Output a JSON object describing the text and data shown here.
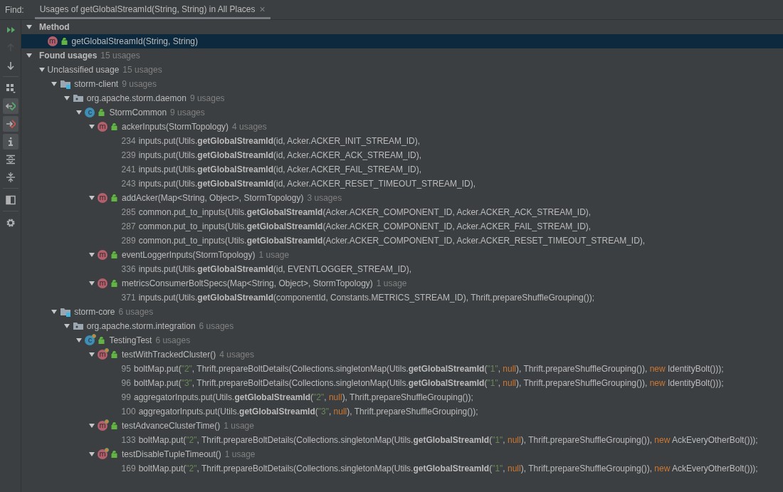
{
  "find_label": "Find:",
  "tab": {
    "title": "Usages of getGlobalStreamId(String, String) in All Places",
    "close": "×",
    "selected": true
  },
  "toolbar": [
    [
      {
        "kind": "rerun",
        "on": false,
        "disabled": false
      },
      {
        "kind": "previous",
        "on": false,
        "disabled": true
      },
      {
        "kind": "next",
        "on": false,
        "disabled": false
      }
    ],
    [
      {
        "kind": "group",
        "on": false,
        "disabled": false
      },
      {
        "kind": "export",
        "on": true,
        "disabled": false
      },
      {
        "kind": "import",
        "on": true,
        "disabled": false
      },
      {
        "kind": "info",
        "on": true,
        "disabled": false
      },
      {
        "kind": "expand-all",
        "on": false,
        "disabled": false
      },
      {
        "kind": "collapse-all",
        "on": false,
        "disabled": false
      }
    ],
    [
      {
        "kind": "preview",
        "on": false,
        "disabled": false
      }
    ],
    [
      {
        "kind": "settings",
        "on": false,
        "disabled": false
      }
    ]
  ],
  "tree": [
    {
      "kind": "group",
      "label": "Method",
      "expanded": true,
      "selected": false,
      "children": [
        {
          "kind": "method",
          "badge": "m",
          "test": false,
          "label": "getGlobalStreamId(String, String)",
          "selected": true
        }
      ]
    },
    {
      "kind": "group",
      "label": "Found usages",
      "count": "15 usages",
      "expanded": true,
      "selected": false,
      "children": [
        {
          "kind": "category",
          "label": "Unclassified usage",
          "count": "15 usages",
          "expanded": true,
          "selected": false,
          "children": [
            {
              "kind": "module",
              "label": "storm-client",
              "count": "9 usages",
              "expanded": true,
              "selected": false,
              "children": [
                {
                  "kind": "package",
                  "label": "org.apache.storm.daemon",
                  "count": "9 usages",
                  "expanded": true,
                  "selected": false,
                  "children": [
                    {
                      "kind": "class",
                      "badge": "c",
                      "test": false,
                      "label": "StormCommon",
                      "count": "9 usages",
                      "expanded": true,
                      "selected": false,
                      "children": [
                        {
                          "kind": "method",
                          "badge": "m",
                          "test": false,
                          "label": "ackerInputs(StormTopology)",
                          "count": "4 usages",
                          "expanded": true,
                          "selected": false,
                          "children": [
                            {
                              "kind": "usage",
                              "line": "234",
                              "selected": false,
                              "segments": [
                                {
                                  "kind": "plain",
                                  "text": "inputs.put(Utils."
                                },
                                {
                                  "kind": "match",
                                  "text": "getGlobalStreamId"
                                },
                                {
                                  "kind": "plain",
                                  "text": "(id, Acker.ACKER_INIT_STREAM_ID),"
                                }
                              ]
                            },
                            {
                              "kind": "usage",
                              "line": "239",
                              "selected": false,
                              "segments": [
                                {
                                  "kind": "plain",
                                  "text": "inputs.put(Utils."
                                },
                                {
                                  "kind": "match",
                                  "text": "getGlobalStreamId"
                                },
                                {
                                  "kind": "plain",
                                  "text": "(id, Acker.ACKER_ACK_STREAM_ID),"
                                }
                              ]
                            },
                            {
                              "kind": "usage",
                              "line": "241",
                              "selected": false,
                              "segments": [
                                {
                                  "kind": "plain",
                                  "text": "inputs.put(Utils."
                                },
                                {
                                  "kind": "match",
                                  "text": "getGlobalStreamId"
                                },
                                {
                                  "kind": "plain",
                                  "text": "(id, Acker.ACKER_FAIL_STREAM_ID),"
                                }
                              ]
                            },
                            {
                              "kind": "usage",
                              "line": "243",
                              "selected": false,
                              "segments": [
                                {
                                  "kind": "plain",
                                  "text": "inputs.put(Utils."
                                },
                                {
                                  "kind": "match",
                                  "text": "getGlobalStreamId"
                                },
                                {
                                  "kind": "plain",
                                  "text": "(id, Acker.ACKER_RESET_TIMEOUT_STREAM_ID),"
                                }
                              ]
                            }
                          ]
                        },
                        {
                          "kind": "method",
                          "badge": "m",
                          "test": false,
                          "label": "addAcker(Map<String, Object>, StormTopology)",
                          "count": "3 usages",
                          "expanded": true,
                          "selected": false,
                          "children": [
                            {
                              "kind": "usage",
                              "line": "285",
                              "selected": false,
                              "segments": [
                                {
                                  "kind": "plain",
                                  "text": "common.put_to_inputs(Utils."
                                },
                                {
                                  "kind": "match",
                                  "text": "getGlobalStreamId"
                                },
                                {
                                  "kind": "plain",
                                  "text": "(Acker.ACKER_COMPONENT_ID, Acker.ACKER_ACK_STREAM_ID),"
                                }
                              ]
                            },
                            {
                              "kind": "usage",
                              "line": "287",
                              "selected": false,
                              "segments": [
                                {
                                  "kind": "plain",
                                  "text": "common.put_to_inputs(Utils."
                                },
                                {
                                  "kind": "match",
                                  "text": "getGlobalStreamId"
                                },
                                {
                                  "kind": "plain",
                                  "text": "(Acker.ACKER_COMPONENT_ID, Acker.ACKER_FAIL_STREAM_ID),"
                                }
                              ]
                            },
                            {
                              "kind": "usage",
                              "line": "289",
                              "selected": false,
                              "segments": [
                                {
                                  "kind": "plain",
                                  "text": "common.put_to_inputs(Utils."
                                },
                                {
                                  "kind": "match",
                                  "text": "getGlobalStreamId"
                                },
                                {
                                  "kind": "plain",
                                  "text": "(Acker.ACKER_COMPONENT_ID, Acker.ACKER_RESET_TIMEOUT_STREAM_ID),"
                                }
                              ]
                            }
                          ]
                        },
                        {
                          "kind": "method",
                          "badge": "m",
                          "test": false,
                          "label": "eventLoggerInputs(StormTopology)",
                          "count": "1 usage",
                          "expanded": true,
                          "selected": false,
                          "children": [
                            {
                              "kind": "usage",
                              "line": "336",
                              "selected": false,
                              "segments": [
                                {
                                  "kind": "plain",
                                  "text": "inputs.put(Utils."
                                },
                                {
                                  "kind": "match",
                                  "text": "getGlobalStreamId"
                                },
                                {
                                  "kind": "plain",
                                  "text": "(id, EVENTLOGGER_STREAM_ID),"
                                }
                              ]
                            }
                          ]
                        },
                        {
                          "kind": "method",
                          "badge": "m",
                          "test": false,
                          "label": "metricsConsumerBoltSpecs(Map<String, Object>, StormTopology)",
                          "count": "1 usage",
                          "expanded": true,
                          "selected": false,
                          "children": [
                            {
                              "kind": "usage",
                              "line": "371",
                              "selected": false,
                              "segments": [
                                {
                                  "kind": "plain",
                                  "text": "inputs.put(Utils."
                                },
                                {
                                  "kind": "match",
                                  "text": "getGlobalStreamId"
                                },
                                {
                                  "kind": "plain",
                                  "text": "(componentId, Constants.METRICS_STREAM_ID), Thrift.prepareShuffleGrouping());"
                                }
                              ]
                            }
                          ]
                        }
                      ]
                    }
                  ]
                }
              ]
            },
            {
              "kind": "module",
              "label": "storm-core",
              "count": "6 usages",
              "expanded": true,
              "selected": false,
              "children": [
                {
                  "kind": "package",
                  "label": "org.apache.storm.integration",
                  "count": "6 usages",
                  "expanded": true,
                  "selected": false,
                  "children": [
                    {
                      "kind": "class",
                      "badge": "c",
                      "test": true,
                      "label": "TestingTest",
                      "count": "6 usages",
                      "expanded": true,
                      "selected": false,
                      "children": [
                        {
                          "kind": "method",
                          "badge": "m",
                          "test": true,
                          "label": "testWithTrackedCluster()",
                          "count": "4 usages",
                          "expanded": true,
                          "selected": false,
                          "children": [
                            {
                              "kind": "usage",
                              "line": "95",
                              "selected": false,
                              "segments": [
                                {
                                  "kind": "plain",
                                  "text": "boltMap.put("
                                },
                                {
                                  "kind": "string",
                                  "text": "\"2\""
                                },
                                {
                                  "kind": "plain",
                                  "text": ", Thrift.prepareBoltDetails(Collections.singletonMap(Utils."
                                },
                                {
                                  "kind": "match",
                                  "text": "getGlobalStreamId"
                                },
                                {
                                  "kind": "plain",
                                  "text": "("
                                },
                                {
                                  "kind": "string",
                                  "text": "\"1\""
                                },
                                {
                                  "kind": "plain",
                                  "text": ", "
                                },
                                {
                                  "kind": "keyword",
                                  "text": "null"
                                },
                                {
                                  "kind": "plain",
                                  "text": "), Thrift.prepareShuffleGrouping()), "
                                },
                                {
                                  "kind": "keyword",
                                  "text": "new"
                                },
                                {
                                  "kind": "plain",
                                  "text": " IdentityBolt()));"
                                }
                              ]
                            },
                            {
                              "kind": "usage",
                              "line": "96",
                              "selected": false,
                              "segments": [
                                {
                                  "kind": "plain",
                                  "text": "boltMap.put("
                                },
                                {
                                  "kind": "string",
                                  "text": "\"3\""
                                },
                                {
                                  "kind": "plain",
                                  "text": ", Thrift.prepareBoltDetails(Collections.singletonMap(Utils."
                                },
                                {
                                  "kind": "match",
                                  "text": "getGlobalStreamId"
                                },
                                {
                                  "kind": "plain",
                                  "text": "("
                                },
                                {
                                  "kind": "string",
                                  "text": "\"1\""
                                },
                                {
                                  "kind": "plain",
                                  "text": ", "
                                },
                                {
                                  "kind": "keyword",
                                  "text": "null"
                                },
                                {
                                  "kind": "plain",
                                  "text": "), Thrift.prepareShuffleGrouping()), "
                                },
                                {
                                  "kind": "keyword",
                                  "text": "new"
                                },
                                {
                                  "kind": "plain",
                                  "text": " IdentityBolt()));"
                                }
                              ]
                            },
                            {
                              "kind": "usage",
                              "line": "99",
                              "selected": false,
                              "segments": [
                                {
                                  "kind": "plain",
                                  "text": "aggregatorInputs.put(Utils."
                                },
                                {
                                  "kind": "match",
                                  "text": "getGlobalStreamId"
                                },
                                {
                                  "kind": "plain",
                                  "text": "("
                                },
                                {
                                  "kind": "string",
                                  "text": "\"2\""
                                },
                                {
                                  "kind": "plain",
                                  "text": ", "
                                },
                                {
                                  "kind": "keyword",
                                  "text": "null"
                                },
                                {
                                  "kind": "plain",
                                  "text": "), Thrift.prepareShuffleGrouping());"
                                }
                              ]
                            },
                            {
                              "kind": "usage",
                              "line": "100",
                              "selected": false,
                              "segments": [
                                {
                                  "kind": "plain",
                                  "text": "aggregatorInputs.put(Utils."
                                },
                                {
                                  "kind": "match",
                                  "text": "getGlobalStreamId"
                                },
                                {
                                  "kind": "plain",
                                  "text": "("
                                },
                                {
                                  "kind": "string",
                                  "text": "\"3\""
                                },
                                {
                                  "kind": "plain",
                                  "text": ", "
                                },
                                {
                                  "kind": "keyword",
                                  "text": "null"
                                },
                                {
                                  "kind": "plain",
                                  "text": "), Thrift.prepareShuffleGrouping());"
                                }
                              ]
                            }
                          ]
                        },
                        {
                          "kind": "method",
                          "badge": "m",
                          "test": true,
                          "label": "testAdvanceClusterTime()",
                          "count": "1 usage",
                          "expanded": true,
                          "selected": false,
                          "children": [
                            {
                              "kind": "usage",
                              "line": "133",
                              "selected": false,
                              "segments": [
                                {
                                  "kind": "plain",
                                  "text": "boltMap.put("
                                },
                                {
                                  "kind": "string",
                                  "text": "\"2\""
                                },
                                {
                                  "kind": "plain",
                                  "text": ", Thrift.prepareBoltDetails(Collections.singletonMap(Utils."
                                },
                                {
                                  "kind": "match",
                                  "text": "getGlobalStreamId"
                                },
                                {
                                  "kind": "plain",
                                  "text": "("
                                },
                                {
                                  "kind": "string",
                                  "text": "\"1\""
                                },
                                {
                                  "kind": "plain",
                                  "text": ", "
                                },
                                {
                                  "kind": "keyword",
                                  "text": "null"
                                },
                                {
                                  "kind": "plain",
                                  "text": "), Thrift.prepareShuffleGrouping()), "
                                },
                                {
                                  "kind": "keyword",
                                  "text": "new"
                                },
                                {
                                  "kind": "plain",
                                  "text": " AckEveryOtherBolt()));"
                                }
                              ]
                            }
                          ]
                        },
                        {
                          "kind": "method",
                          "badge": "m",
                          "test": true,
                          "label": "testDisableTupleTimeout()",
                          "count": "1 usage",
                          "expanded": true,
                          "selected": false,
                          "children": [
                            {
                              "kind": "usage",
                              "line": "169",
                              "selected": false,
                              "segments": [
                                {
                                  "kind": "plain",
                                  "text": "boltMap.put("
                                },
                                {
                                  "kind": "string",
                                  "text": "\"2\""
                                },
                                {
                                  "kind": "plain",
                                  "text": ", Thrift.prepareBoltDetails(Collections.singletonMap(Utils."
                                },
                                {
                                  "kind": "match",
                                  "text": "getGlobalStreamId"
                                },
                                {
                                  "kind": "plain",
                                  "text": "("
                                },
                                {
                                  "kind": "string",
                                  "text": "\"1\""
                                },
                                {
                                  "kind": "plain",
                                  "text": ", "
                                },
                                {
                                  "kind": "keyword",
                                  "text": "null"
                                },
                                {
                                  "kind": "plain",
                                  "text": "), Thrift.prepareShuffleGrouping()), "
                                },
                                {
                                  "kind": "keyword",
                                  "text": "new"
                                },
                                {
                                  "kind": "plain",
                                  "text": " AckEveryOtherBolt()));"
                                }
                              ]
                            }
                          ]
                        }
                      ]
                    }
                  ]
                }
              ]
            }
          ]
        }
      ]
    }
  ]
}
